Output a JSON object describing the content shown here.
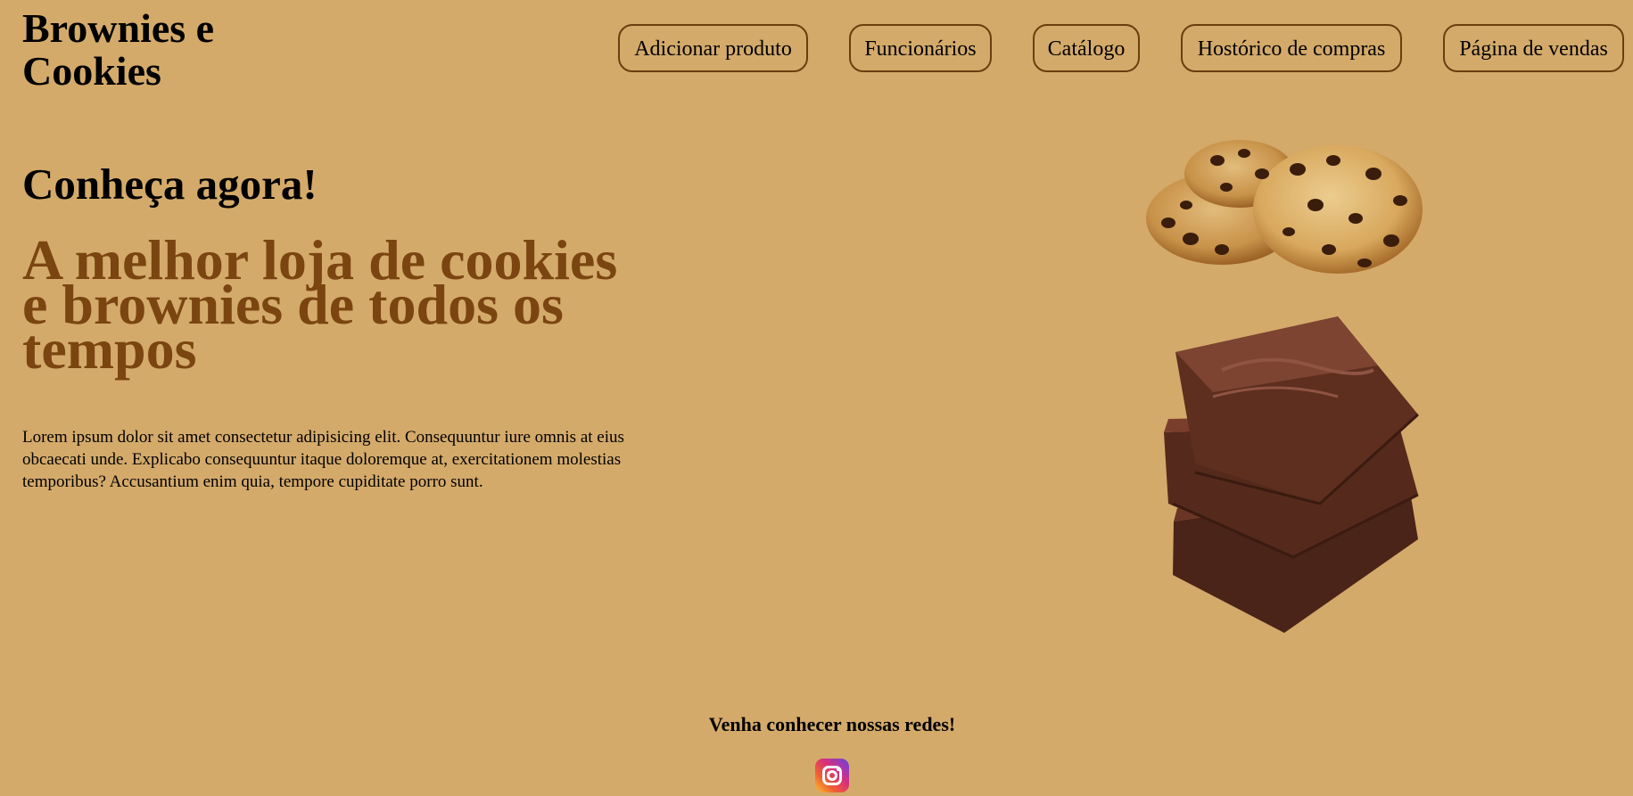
{
  "brand": {
    "name": "Brownies e Cookies"
  },
  "nav": {
    "items": [
      {
        "label": "Adicionar produto"
      },
      {
        "label": "Funcionários"
      },
      {
        "label": "Catálogo"
      },
      {
        "label": "Hostórico de compras"
      },
      {
        "label": "Página de vendas"
      }
    ]
  },
  "hero": {
    "kicker": "Conheça agora!",
    "headline": "A melhor loja de cookies e brownies de todos os tempos",
    "body": "Lorem ipsum dolor sit amet consectetur adipisicing elit. Consequuntur iure omnis at eius obcaecati unde. Explicabo consequuntur itaque doloremque at, exercitationem molestias temporibus? Accusantium enim quia, tempore cupiditate porro sunt."
  },
  "images": {
    "cookies_icon": "cookies-image",
    "brownies_icon": "brownies-image"
  },
  "footer": {
    "title": "Venha conhecer nossas redes!",
    "social_icon": "instagram-icon"
  },
  "colors": {
    "background": "#d4aa6a",
    "headline": "#7a4510",
    "nav_border": "#6b3d0f"
  }
}
